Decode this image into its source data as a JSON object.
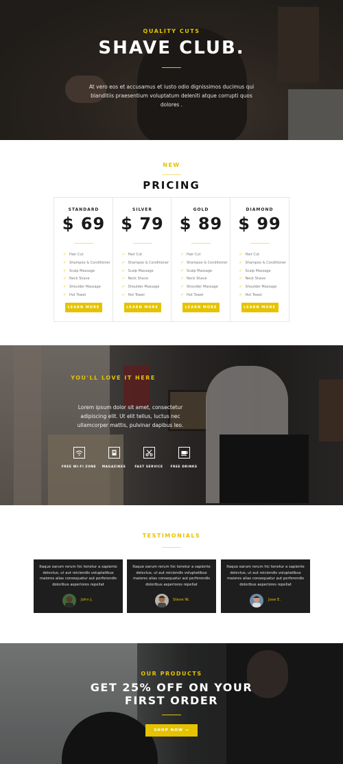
{
  "hero": {
    "eyebrow": "QUALITY CUTS",
    "title": "SHAVE CLUB.",
    "description": "At vero eos et accusamus et iusto odio dignissimos ducimus qui blanditiis praesentium voluptatum deleniti atque corrupti quos dolores ."
  },
  "pricing": {
    "eyebrow": "NEW",
    "title": "PRICING",
    "plans": [
      {
        "name": "STANDARD",
        "price": "$ 69",
        "features": [
          "Hair Cut",
          "Shampoo & Conditioner",
          "Scalp Massage",
          "Neck Shave",
          "Shoulder Massage",
          "Hot Towel"
        ],
        "button": "LEARN MORE"
      },
      {
        "name": "SILVER",
        "price": "$ 79",
        "features": [
          "Hair Cut",
          "Shampoo & Conditioner",
          "Scalp Massage",
          "Neck Shave",
          "Shoulder Massage",
          "Hot Towel"
        ],
        "button": "LEARN MORE"
      },
      {
        "name": "GOLD",
        "price": "$ 89",
        "features": [
          "Hair Cut",
          "Shampoo & Conditioner",
          "Scalp Massage",
          "Neck Shave",
          "Shoulder Massage",
          "Hot Towel"
        ],
        "button": "LEARN MORE"
      },
      {
        "name": "DIAMOND",
        "price": "$ 99",
        "features": [
          "Hair Cut",
          "Shampoo & Conditioner",
          "Scalp Massage",
          "Neck Shave",
          "Shoulder Massage",
          "Hot Towel"
        ],
        "button": "LEARN MORE"
      }
    ]
  },
  "love": {
    "eyebrow": "YOU'LL LOVE IT HERE",
    "description": "Lorem ipsum dolor sit amet, consectetur adipiscing elit. Ut elit tellus, luctus nec ullamcorper mattis, pulvinar dapibus leo.",
    "features": [
      {
        "icon": "wifi-icon",
        "label": "FREE WI-FI ZONE"
      },
      {
        "icon": "magazine-icon",
        "label": "MAGAZINES"
      },
      {
        "icon": "scissors-icon",
        "label": "FAST SERVICE"
      },
      {
        "icon": "coffee-cup-icon",
        "label": "FREE DRINKS"
      }
    ]
  },
  "testimonials": {
    "eyebrow": "TESTIMONIALS",
    "items": [
      {
        "quote": "Itaque earum rerum hic tenetur a sapiente delectus, ut aut reiciendis voluptatibus maiores alias consequatur aut perferendis doloribus asperiores repellat",
        "name": "John J."
      },
      {
        "quote": "Itaque earum rerum hic tenetur a sapiente delectus, ut aut reiciendis voluptatibus maiores alias consequatur aut perferendis doloribus asperiores repellat",
        "name": "Steve W."
      },
      {
        "quote": "Itaque earum rerum hic tenetur a sapiente delectus, ut aut reiciendis voluptatibus maiores alias consequatur aut perferendis doloribus asperiores repellat",
        "name": "Jose E."
      }
    ]
  },
  "products": {
    "eyebrow": "OUR PRODUCTS",
    "title": "GET 25% OFF ON YOUR FIRST ORDER",
    "button": "SHOP NOW"
  },
  "colors": {
    "accent": "#e5c300",
    "dark_card": "#1e1e1e",
    "heading": "#111111"
  }
}
